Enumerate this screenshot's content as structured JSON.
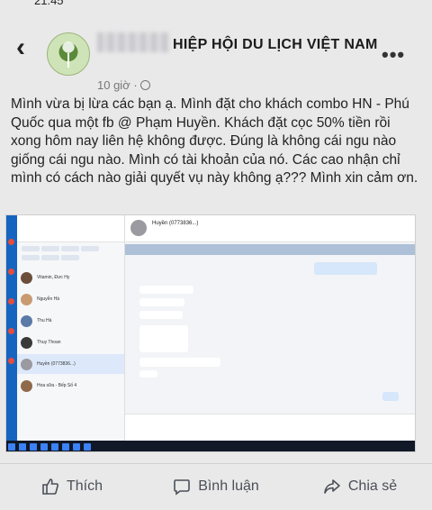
{
  "status_bar": {
    "time": "21:45"
  },
  "post": {
    "group_name": "HIỆP HỘI DU LỊCH VIỆT NAM",
    "time": "10 giờ",
    "body": "Mình vừa bị lừa các bạn ạ. Mình đặt cho khách combo HN - Phú Quốc qua một fb @ Phạm Huyền. Khách đặt cọc 50% tiền rồi xong hôm nay liên hệ không được. Đúng là không cái ngu nào giống cái ngu nào. Mình có tài khoản của nó. Các cao nhận chỉ mình có cách nào giải quyết vụ này không ạ??? Mình xin cảm ơn."
  },
  "screenshot": {
    "chat_title": "Huyền (0773836...)",
    "contacts": [
      "Vitamin, Đưc Hy",
      "Nguyễn Hà",
      "Thu Hà",
      "Thuy Thoan",
      "Huyền (0773836...)",
      "Hoa sữa - Bếp Số 4"
    ]
  },
  "actions": {
    "like": "Thích",
    "comment": "Bình luận",
    "share": "Chia sẻ"
  },
  "colors": {
    "background": "#e9e9ea",
    "accent": "#1565c0"
  }
}
